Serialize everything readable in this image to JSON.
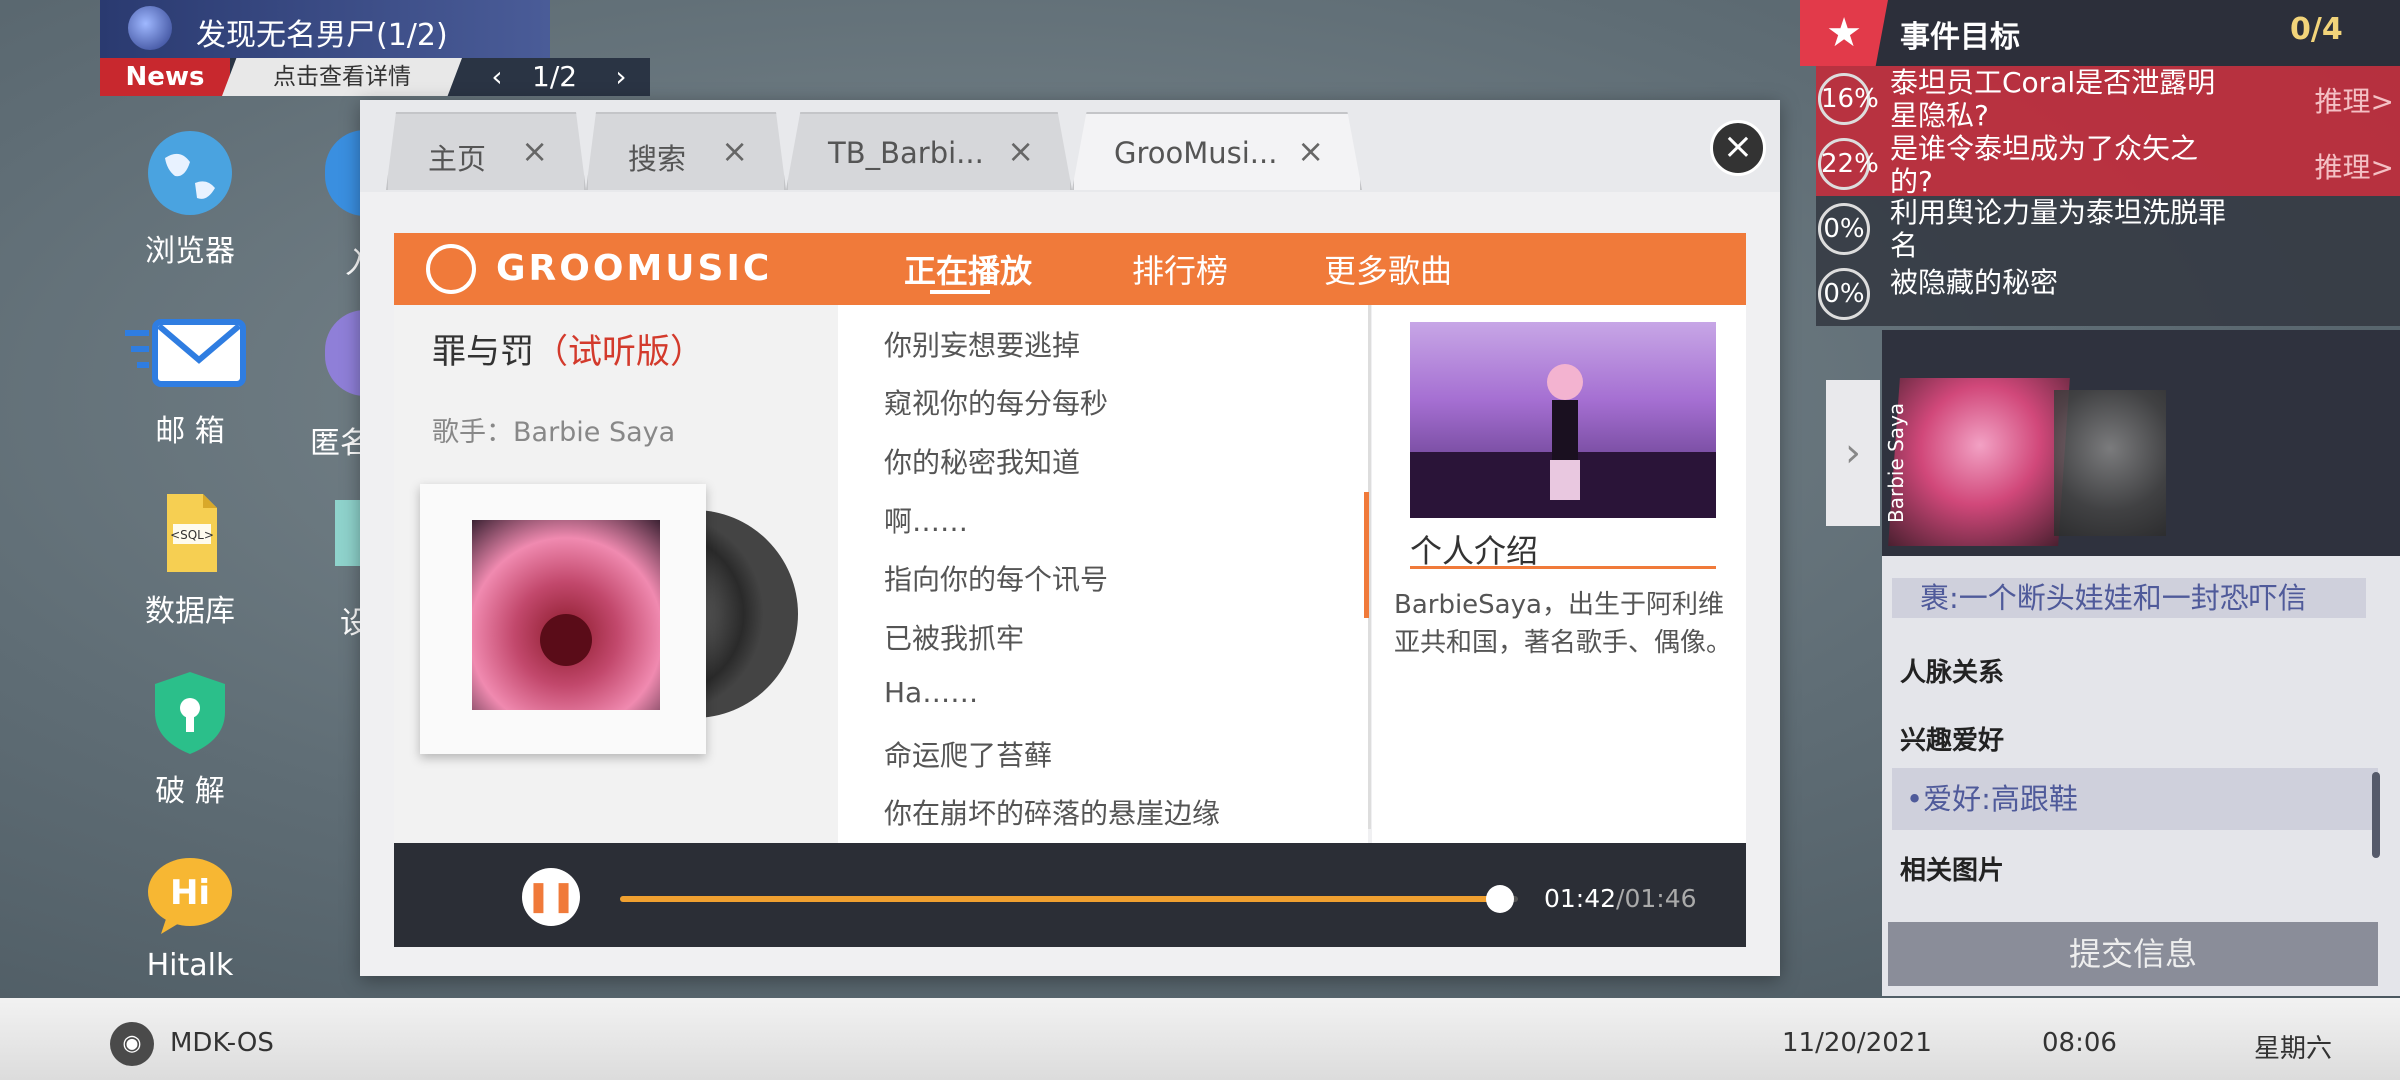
{
  "news": {
    "headline": "发现无名男尸(1/2)",
    "badge": "News",
    "link": "点击查看详情",
    "page": "1/2"
  },
  "desktop_icons": [
    {
      "label": "浏览器",
      "icon": "globe-icon"
    },
    {
      "label": "邮 箱",
      "icon": "mail-icon"
    },
    {
      "label": "数据库",
      "icon": "sql-file-icon"
    },
    {
      "label": "破 解",
      "icon": "shield-key-icon"
    },
    {
      "label": "Hitalk",
      "icon": "hitalk-icon"
    }
  ],
  "desktop_icons_partial": [
    "入",
    "匿名",
    "设"
  ],
  "tabs": [
    {
      "label": "主页"
    },
    {
      "label": "搜索"
    },
    {
      "label": "TB_Barbi..."
    },
    {
      "label": "GrooMusi..."
    }
  ],
  "music": {
    "brand": "GROOMUSIC",
    "nav": [
      "正在播放",
      "排行榜",
      "更多歌曲"
    ],
    "song_title": "罪与罚",
    "song_trial": "（试听版）",
    "singer": "歌手：Barbie Saya",
    "lyrics": [
      "你别妄想要逃掉",
      "窥视你的每分每秒",
      "你的秘密我知道",
      "啊……",
      "指向你的每个讯号",
      "已被我抓牢",
      "Ha……",
      "命运爬了苔藓",
      "你在崩坏的碎落的悬崖边缘"
    ],
    "bio_title": "个人介绍",
    "bio_text": "BarbieSaya，出生于阿利维亚共和国，著名歌手、偶像。",
    "time_current": "01:42",
    "time_total": "/01:46",
    "progress": 0.98
  },
  "objectives": {
    "title": "事件目标",
    "count": "0/4",
    "items": [
      {
        "pct": "16%",
        "text": "泰坦员工Coral是否泄露明星隐私?",
        "action": "推理>",
        "style": "red"
      },
      {
        "pct": "22%",
        "text": "是谁令泰坦成为了众矢之的?",
        "action": "推理>",
        "style": "red"
      },
      {
        "pct": "0%",
        "text": "利用舆论力量为泰坦洗脱罪名",
        "action": "",
        "style": "dark"
      },
      {
        "pct": "0%",
        "text": "被隐藏的秘密",
        "action": "",
        "style": "dark"
      }
    ]
  },
  "profile": {
    "portrait_name": "Barbie Saya",
    "item1": "裹:一个断头娃娃和一封恐吓信",
    "section_relations": "人脉关系",
    "section_hobbies": "兴趣爱好",
    "hobby": "•爱好:高跟鞋",
    "section_images": "相关图片",
    "submit": "提交信息"
  },
  "taskbar": {
    "os_name": "MDK-OS",
    "date": "11/20/2021",
    "time": "08:06",
    "weekday": "星期六"
  },
  "colors": {
    "brand_orange": "#f07a3a",
    "news_red": "#c8282e",
    "objective_red": "#c82837",
    "player_dark": "#2b2e36"
  }
}
